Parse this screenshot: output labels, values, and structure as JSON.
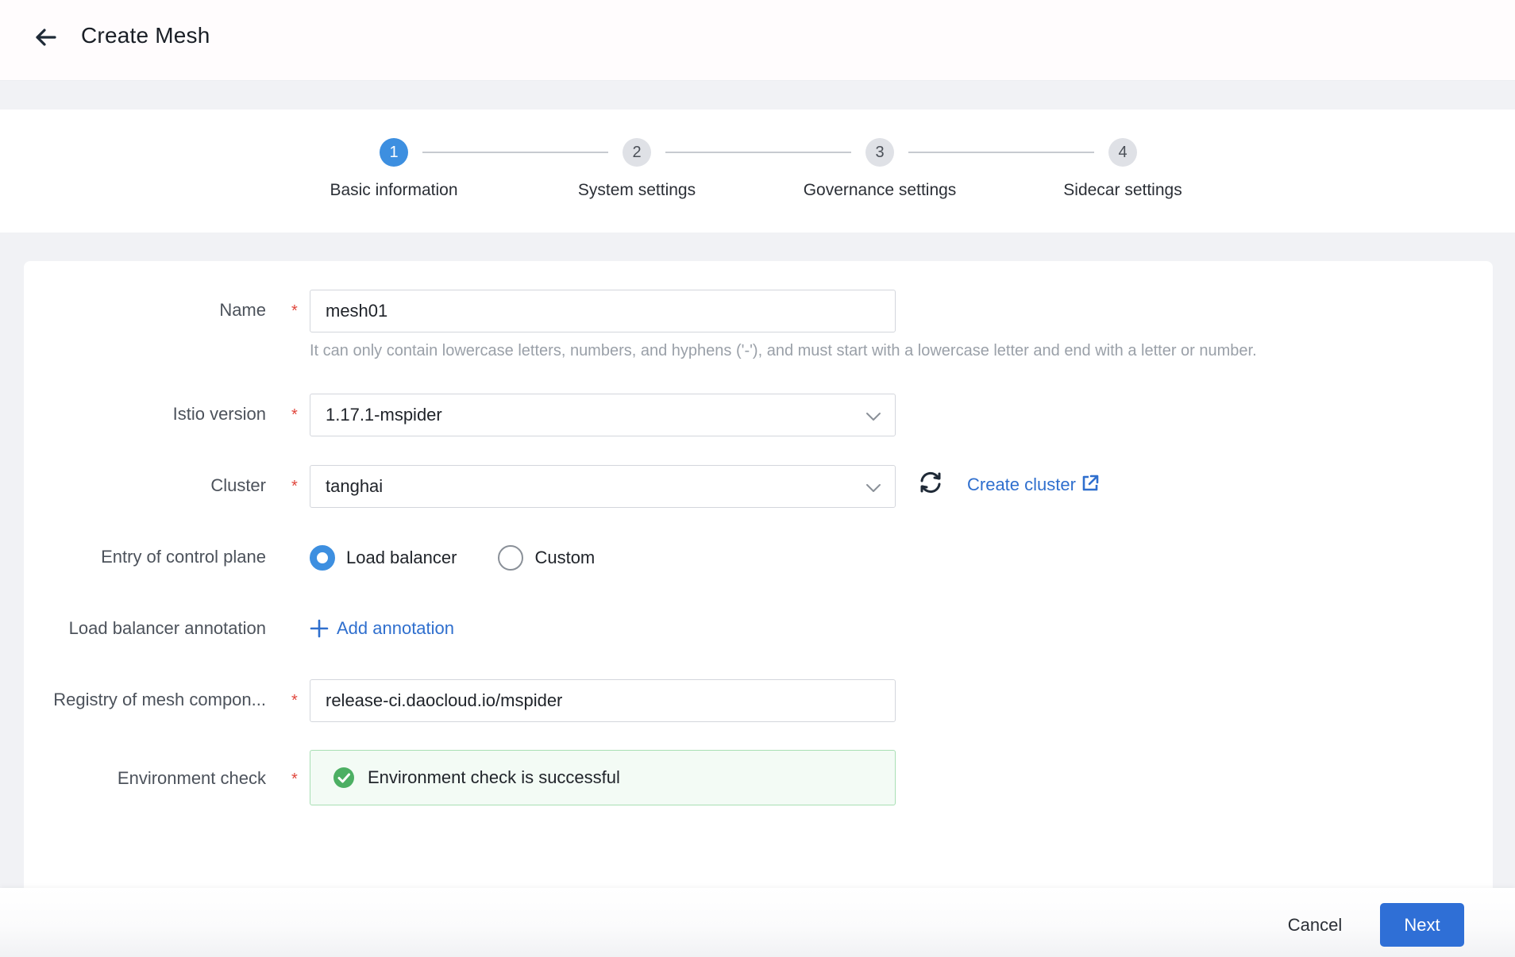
{
  "header": {
    "title": "Create Mesh",
    "back_icon": "arrow-left-icon"
  },
  "stepper": {
    "active_step": 1,
    "steps": [
      {
        "number": "1",
        "label": "Basic information"
      },
      {
        "number": "2",
        "label": "System settings"
      },
      {
        "number": "3",
        "label": "Governance settings"
      },
      {
        "number": "4",
        "label": "Sidecar settings"
      }
    ]
  },
  "form": {
    "name": {
      "label": "Name",
      "value": "mesh01",
      "hint": "It can only contain lowercase letters, numbers, and hyphens ('-'), and must start with a lowercase letter and end with a letter or number."
    },
    "istio_version": {
      "label": "Istio version",
      "value": "1.17.1-mspider"
    },
    "cluster": {
      "label": "Cluster",
      "value": "tanghai",
      "create_link": "Create cluster"
    },
    "entry": {
      "label": "Entry of control plane",
      "options": [
        "Load balancer",
        "Custom"
      ],
      "selected": "Load balancer"
    },
    "lb_annotation": {
      "label": "Load balancer annotation",
      "add_label": "Add annotation"
    },
    "registry": {
      "label": "Registry of mesh compon...",
      "value": "release-ci.daocloud.io/mspider"
    },
    "env_check": {
      "label": "Environment check",
      "status": "Environment check is successful"
    },
    "required_mark": "*"
  },
  "footer": {
    "cancel": "Cancel",
    "next": "Next"
  },
  "colors": {
    "primary": "#2f6fd6",
    "step_active": "#3d8fe0",
    "required": "#e0463c",
    "success": "#4caf63"
  }
}
